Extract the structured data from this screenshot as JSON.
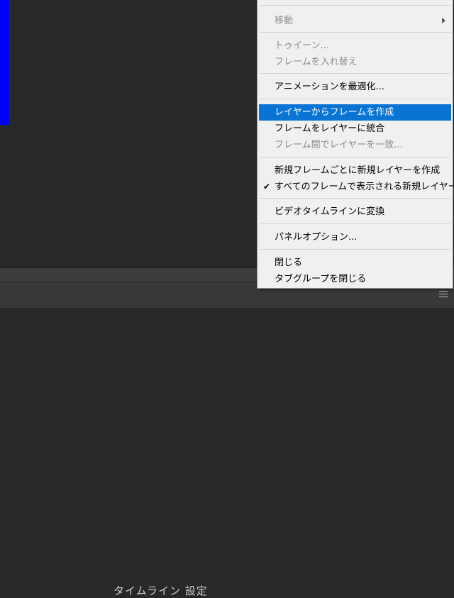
{
  "bottom_panel": {
    "clipped_text": "タイムライン 設定"
  },
  "colors": {
    "menu_bg": "#f0f0f0",
    "highlight": "#0a74d4",
    "disabled_text": "#8d8d8d",
    "canvas_bg": "#282828",
    "frame_color": "#0000ff"
  },
  "menu": {
    "items": [
      {
        "label": "移動",
        "disabled": true,
        "has_submenu": true
      },
      {
        "label": "トゥイーン...",
        "disabled": true
      },
      {
        "label": "フレームを入れ替え",
        "disabled": true
      },
      {
        "label": "アニメーションを最適化..."
      },
      {
        "label": "レイヤーからフレームを作成",
        "highlighted": true
      },
      {
        "label": "フレームをレイヤーに統合"
      },
      {
        "label": "フレーム間でレイヤーを一致...",
        "disabled": true
      },
      {
        "label": "新規フレームごとに新規レイヤーを作成"
      },
      {
        "label": "すべてのフレームで表示される新規レイヤー",
        "checked": true
      },
      {
        "label": "ビデオタイムラインに変換"
      },
      {
        "label": "パネルオプション..."
      },
      {
        "label": "閉じる"
      },
      {
        "label": "タブグループを閉じる"
      }
    ]
  }
}
